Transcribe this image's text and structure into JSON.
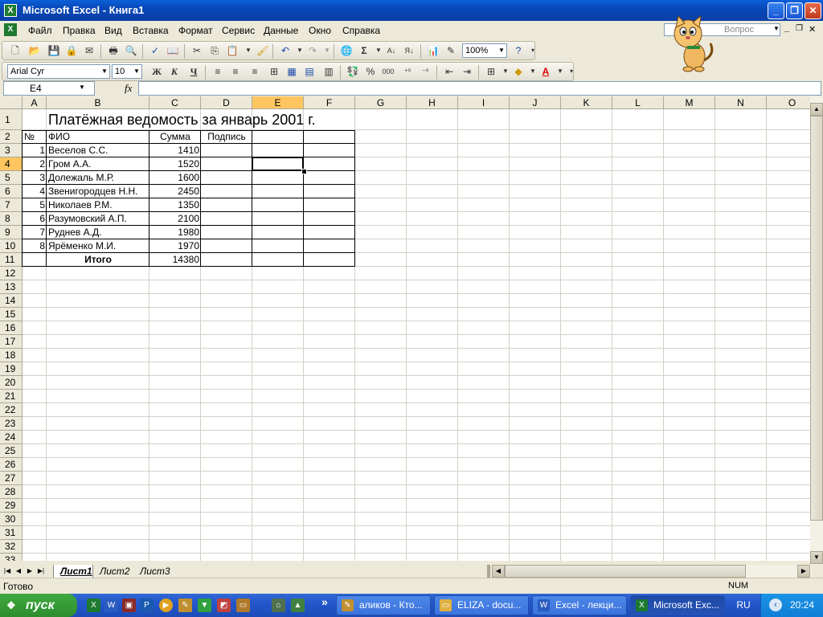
{
  "window": {
    "title": "Microsoft Excel - Книга1",
    "icon_letter": "X"
  },
  "window_buttons": {
    "minimize": "_",
    "restore": "❐",
    "close": "✕"
  },
  "menu": [
    "Файл",
    "Правка",
    "Вид",
    "Вставка",
    "Формат",
    "Сервис",
    "Данные",
    "Окно",
    "Справка"
  ],
  "help_box": {
    "placeholder": "Вопрос"
  },
  "doc_controls": {
    "minimize": "_",
    "restore": "❐",
    "close": "✕"
  },
  "standard_toolbar": {
    "zoom": "100%"
  },
  "formatting_toolbar": {
    "font": "Arial Cyr",
    "size": "10",
    "bold": "Ж",
    "italic": "К",
    "underline": "Ч",
    "percent": "%",
    "thousands": "000"
  },
  "formula_bar": {
    "name_box": "E4",
    "fx_label": "fx",
    "value": ""
  },
  "columns": [
    "A",
    "B",
    "C",
    "D",
    "E",
    "F",
    "G",
    "H",
    "I",
    "J",
    "K",
    "L",
    "M",
    "N",
    "O"
  ],
  "rows": [
    "1",
    "2",
    "3",
    "4",
    "5",
    "6",
    "7",
    "8",
    "9",
    "10",
    "11",
    "12",
    "13",
    "14",
    "15",
    "16",
    "17",
    "18",
    "19",
    "20",
    "21",
    "22",
    "23",
    "24",
    "25",
    "26",
    "27",
    "28",
    "29",
    "30",
    "31",
    "32",
    "33"
  ],
  "selected_cell": "E4",
  "sheet": {
    "title": "Платёжная ведомость за январь 2001 г.",
    "headers": {
      "num": "№",
      "name": "ФИО",
      "sum": "Сумма",
      "sign": "Подпись"
    },
    "records": [
      {
        "num": "1",
        "name": "Веселов С.С.",
        "sum": "1410"
      },
      {
        "num": "2",
        "name": "Гром А.А.",
        "sum": "1520"
      },
      {
        "num": "3",
        "name": "Долежаль М.Р.",
        "sum": "1600"
      },
      {
        "num": "4",
        "name": "Звенигородцев Н.Н.",
        "sum": "2450"
      },
      {
        "num": "5",
        "name": "Николаев Р.М.",
        "sum": "1350"
      },
      {
        "num": "6",
        "name": "Разумовский А.П.",
        "sum": "2100"
      },
      {
        "num": "7",
        "name": "Руднев А.Д.",
        "sum": "1980"
      },
      {
        "num": "8",
        "name": "Ярёменко М.И.",
        "sum": "1970"
      }
    ],
    "total_label": "Итого",
    "total_value": "14380"
  },
  "sheet_tabs": [
    "Лист1",
    "Лист2",
    "Лист3"
  ],
  "active_tab": "Лист1",
  "status": {
    "text": "Готово",
    "num": "NUM"
  },
  "taskbar": {
    "start": "пуск",
    "quick_launch": [
      "excel-icon",
      "word-icon",
      "access-icon",
      "publisher-icon",
      "media-player-icon",
      "pencil-icon",
      "filter-icon",
      "image-icon",
      "folder-icon",
      "network-icon"
    ],
    "more": "»",
    "buttons": [
      {
        "label": "аликов - Кто...",
        "icon": "pencil-icon"
      },
      {
        "label": "ELIZA - docu...",
        "icon": "folder-icon"
      },
      {
        "label": "Excel - лекци...",
        "icon": "word-icon"
      },
      {
        "label": "Microsoft Exc...",
        "icon": "excel-icon",
        "active": true
      }
    ],
    "lang": "RU",
    "time": "20:24"
  }
}
